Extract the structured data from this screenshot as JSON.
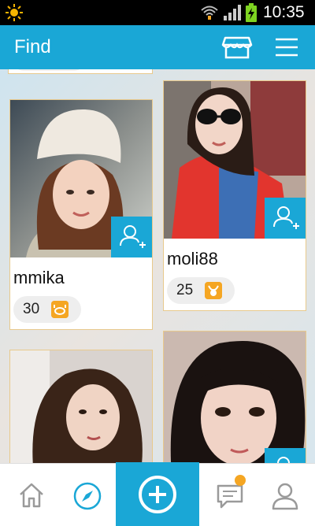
{
  "status_bar": {
    "time": "10:35"
  },
  "app_bar": {
    "title": "Find"
  },
  "users": [
    {
      "name": "mmika",
      "age": "30",
      "zodiac_icon": "crab-icon"
    },
    {
      "name": "moli88",
      "age": "25",
      "zodiac_icon": "goat-icon"
    }
  ],
  "colors": {
    "accent": "#1aa7d6",
    "badge": "#f5a623",
    "card_border": "#e8c98c"
  }
}
